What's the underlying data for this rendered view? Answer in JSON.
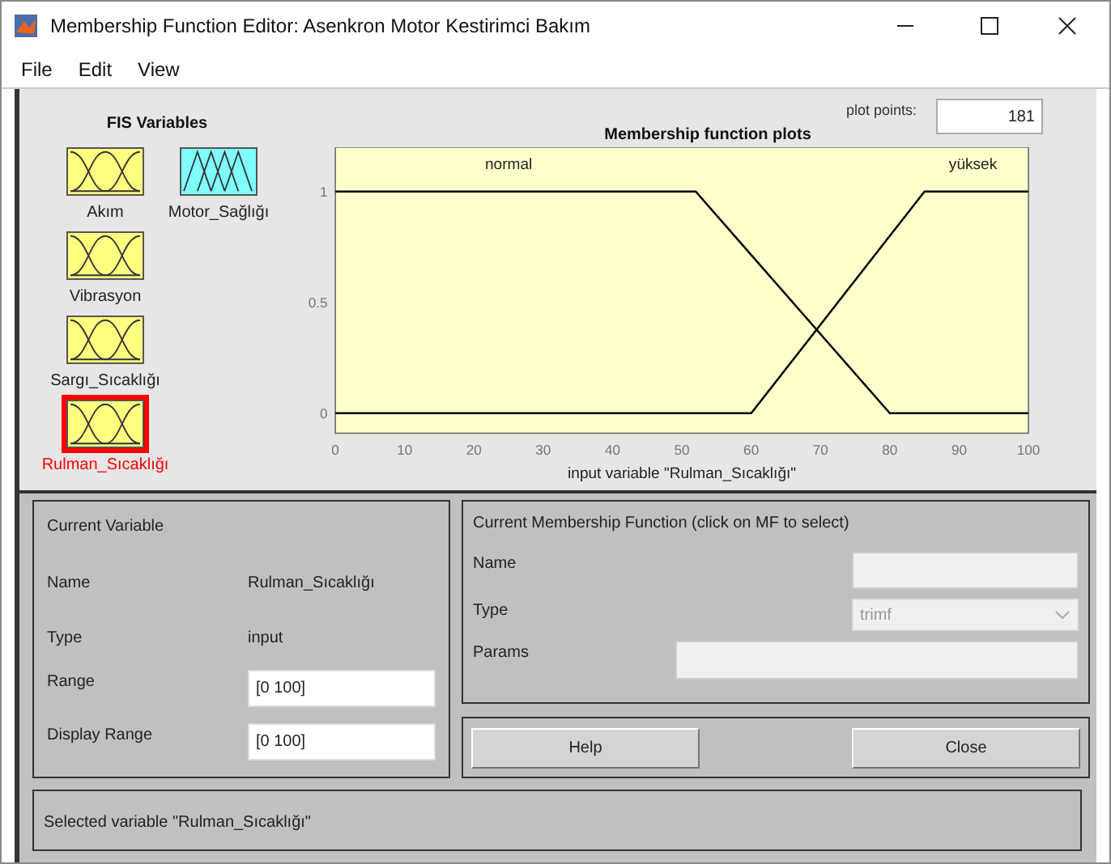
{
  "window": {
    "title": "Membership Function Editor: Asenkron Motor Kestirimci Bakım"
  },
  "menu": [
    "File",
    "Edit",
    "View"
  ],
  "fis_variables": {
    "title": "FIS Variables",
    "items": [
      {
        "name": "Akım",
        "kind": "input",
        "selected": false
      },
      {
        "name": "Vibrasyon",
        "kind": "input",
        "selected": false
      },
      {
        "name": "Sargı_Sıcaklığı",
        "kind": "input",
        "selected": false
      },
      {
        "name": "Rulman_Sıcaklığı",
        "kind": "input",
        "selected": true
      },
      {
        "name": "Motor_Sağlığı",
        "kind": "output",
        "selected": false
      }
    ]
  },
  "plot_points": {
    "label": "plot points:",
    "value": "181"
  },
  "plot": {
    "chart_data": {
      "type": "line",
      "title": "Membership function plots",
      "xlabel": "input variable \"Rulman_Sıcaklığı\"",
      "x": [
        0,
        52,
        60,
        80,
        85,
        100
      ],
      "series": [
        {
          "name": "normal",
          "color": "#000000",
          "values": [
            1,
            1,
            0.714,
            0,
            0,
            0
          ]
        },
        {
          "name": "yüksek",
          "color": "#000000",
          "values": [
            0,
            0,
            0,
            0.8,
            1,
            1
          ]
        }
      ],
      "xlim": [
        0,
        100
      ],
      "ylim": [
        -0.09,
        1.2
      ],
      "xticks": [
        0,
        10,
        20,
        30,
        40,
        50,
        60,
        70,
        80,
        90,
        100
      ],
      "yticks": [
        0,
        0.5,
        1
      ]
    }
  },
  "current_variable": {
    "title": "Current Variable",
    "name_label": "Name",
    "name": "Rulman_Sıcaklığı",
    "type_label": "Type",
    "type": "input",
    "range_label": "Range",
    "range": "[0 100]",
    "display_range_label": "Display Range",
    "display_range": "[0 100]"
  },
  "current_mf": {
    "title": "Current Membership Function (click on MF to select)",
    "name_label": "Name",
    "type_label": "Type",
    "type": "trimf",
    "params_label": "Params"
  },
  "buttons": [
    "Help",
    "Close"
  ],
  "status": "Selected variable \"Rulman_Sıcaklığı\""
}
